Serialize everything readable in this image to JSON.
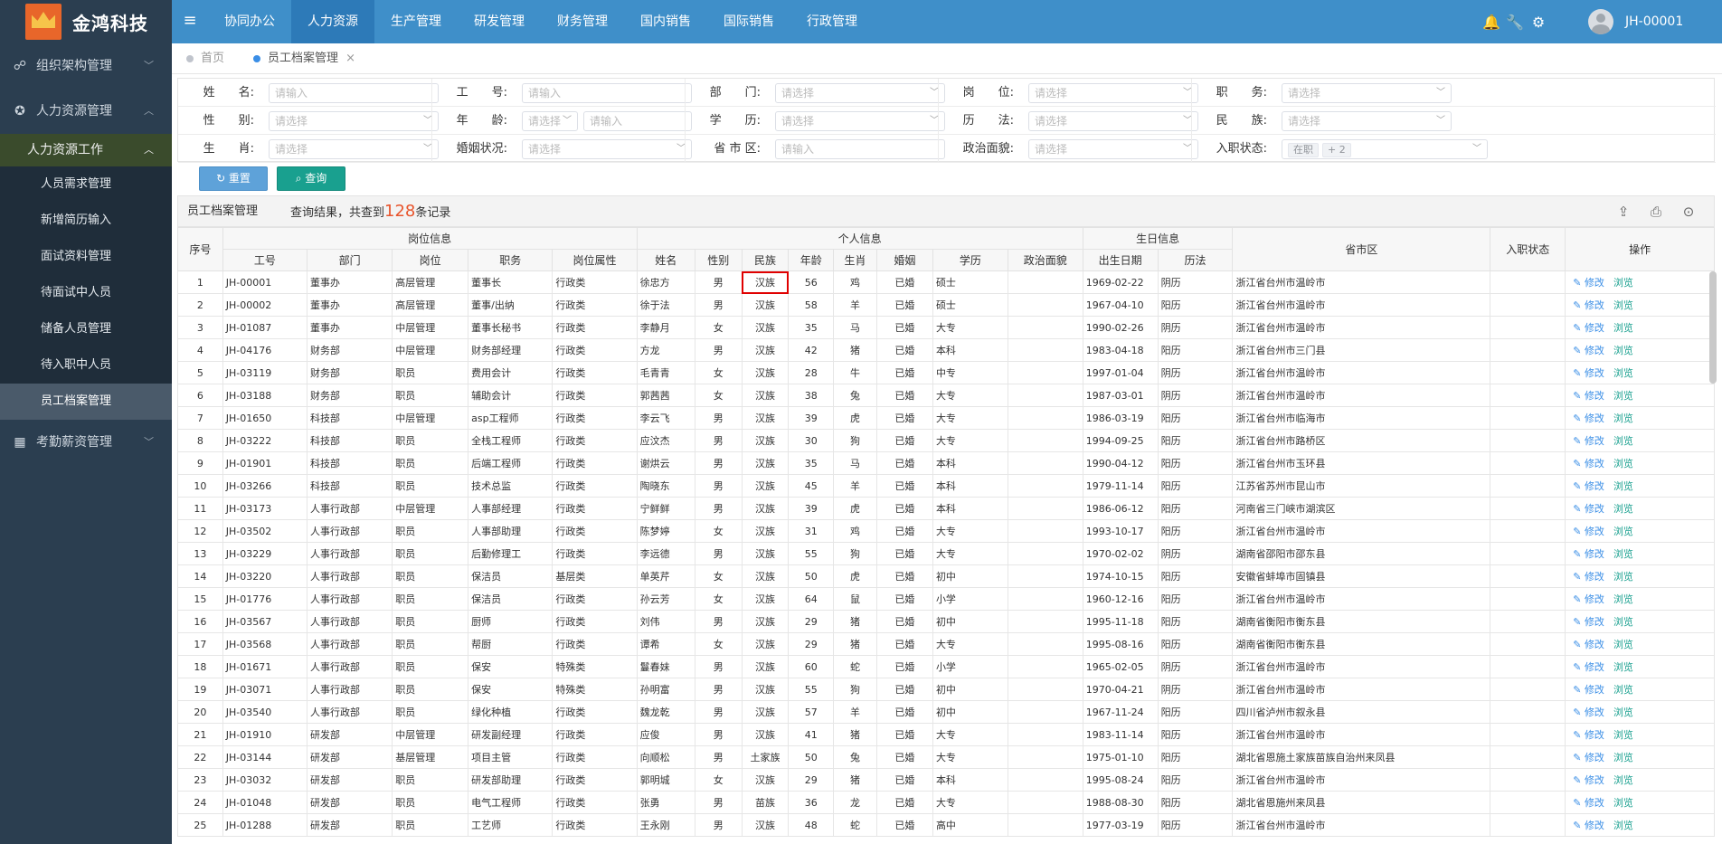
{
  "app": {
    "name": "金鸿科技",
    "menu_icon": "hamburger-icon"
  },
  "nav": [
    "协同办公",
    "人力资源",
    "生产管理",
    "研发管理",
    "财务管理",
    "国内销售",
    "国际销售",
    "行政管理"
  ],
  "nav_active": "人力资源",
  "topbar": {
    "icons": [
      "bell-icon",
      "wrench-icon",
      "gear-icon"
    ],
    "user": "JH-00001"
  },
  "sidebar": {
    "groups": [
      {
        "label": "组织架构管理",
        "icon": "org-chart-icon",
        "chevron": "chevron-down-icon"
      },
      {
        "label": "人力资源管理",
        "icon": "gear-icon",
        "chevron": "chevron-up-icon"
      }
    ],
    "subgroup": "人力资源工作",
    "items": [
      "人员需求管理",
      "新增简历输入",
      "面试资料管理",
      "待面试中人员",
      "储备人员管理",
      "待入职中人员",
      "员工档案管理"
    ],
    "active_item": "员工档案管理",
    "last_group": {
      "label": "考勤薪资管理",
      "icon": "grid-icon"
    }
  },
  "tabs": [
    {
      "label": "首页",
      "dot": "#c0c4cc"
    },
    {
      "label": "员工档案管理",
      "dot": "#3a8ee6",
      "close": "×"
    }
  ],
  "filters": {
    "row1": [
      {
        "label": "姓　　名:",
        "placeholder": "请输入"
      },
      {
        "label": "工　　号:",
        "placeholder": "请输入"
      },
      {
        "label": "部　　门:",
        "placeholder": "请选择"
      },
      {
        "label": "岗　　位:",
        "placeholder": "请选择"
      },
      {
        "label": "职　　务:",
        "placeholder": "请选择"
      }
    ],
    "row2": [
      {
        "label": "性　　别:",
        "placeholder": "请选择"
      },
      {
        "label": "年　　龄:",
        "placeholder": "请选择",
        "placeholder2": "请输入"
      },
      {
        "label": "学　　历:",
        "placeholder": "请选择"
      },
      {
        "label": "历　　法:",
        "placeholder": "请选择"
      },
      {
        "label": "民　　族:",
        "placeholder": "请选择"
      }
    ],
    "row3": [
      {
        "label": "生　　肖:",
        "placeholder": "请选择"
      },
      {
        "label": "婚姻状况:",
        "placeholder": "请选择"
      },
      {
        "label": "省 市 区:",
        "placeholder": "请输入"
      },
      {
        "label": "政治面貌:",
        "placeholder": "请选择"
      },
      {
        "label": "入职状态:",
        "tags": [
          "在职",
          "+ 2"
        ]
      }
    ]
  },
  "buttons": {
    "reset": "↻ 重置",
    "query": "⌕ 查询"
  },
  "list": {
    "title": "员工档案管理",
    "summary_pre": "查询结果，共查到",
    "count": "128",
    "summary_post": "条记录",
    "tools": [
      "export-icon",
      "print-icon",
      "locate-icon"
    ]
  },
  "table": {
    "group_headers": {
      "seq": "序号",
      "post": "岗位信息",
      "personal": "个人信息",
      "birth": "生日信息",
      "region": "省市区",
      "status": "入职状态",
      "ops": "操作"
    },
    "columns": [
      "工号",
      "部门",
      "岗位",
      "职务",
      "岗位属性",
      "姓名",
      "性别",
      "民族",
      "年龄",
      "生肖",
      "婚姻",
      "学历",
      "政治面貌",
      "出生日期",
      "历法"
    ],
    "op_edit": "修改",
    "op_view": "浏览",
    "rows": [
      [
        "1",
        "JH-00001",
        "董事办",
        "高层管理",
        "董事长",
        "行政类",
        "徐忠方",
        "男",
        "汉族",
        "56",
        "鸡",
        "已婚",
        "硕士",
        "",
        "1969-02-22",
        "阴历",
        "浙江省台州市温岭市",
        ""
      ],
      [
        "2",
        "JH-00002",
        "董事办",
        "高层管理",
        "董事/出纳",
        "行政类",
        "徐于法",
        "男",
        "汉族",
        "58",
        "羊",
        "已婚",
        "硕士",
        "",
        "1967-04-10",
        "阳历",
        "浙江省台州市温岭市",
        ""
      ],
      [
        "3",
        "JH-01087",
        "董事办",
        "中层管理",
        "董事长秘书",
        "行政类",
        "李静月",
        "女",
        "汉族",
        "35",
        "马",
        "已婚",
        "大专",
        "",
        "1990-02-26",
        "阴历",
        "浙江省台州市温岭市",
        ""
      ],
      [
        "4",
        "JH-04176",
        "财务部",
        "中层管理",
        "财务部经理",
        "行政类",
        "方龙",
        "男",
        "汉族",
        "42",
        "猪",
        "已婚",
        "本科",
        "",
        "1983-04-18",
        "阳历",
        "浙江省台州市三门县",
        ""
      ],
      [
        "5",
        "JH-03119",
        "财务部",
        "职员",
        "费用会计",
        "行政类",
        "毛青青",
        "女",
        "汉族",
        "28",
        "牛",
        "已婚",
        "中专",
        "",
        "1997-01-04",
        "阴历",
        "浙江省台州市温岭市",
        ""
      ],
      [
        "6",
        "JH-03188",
        "财务部",
        "职员",
        "辅助会计",
        "行政类",
        "郭茜茜",
        "女",
        "汉族",
        "38",
        "兔",
        "已婚",
        "大专",
        "",
        "1987-03-01",
        "阴历",
        "浙江省台州市温岭市",
        ""
      ],
      [
        "7",
        "JH-01650",
        "科技部",
        "中层管理",
        "asp工程师",
        "行政类",
        "李云飞",
        "男",
        "汉族",
        "39",
        "虎",
        "已婚",
        "大专",
        "",
        "1986-03-19",
        "阳历",
        "浙江省台州市临海市",
        ""
      ],
      [
        "8",
        "JH-03222",
        "科技部",
        "职员",
        "全栈工程师",
        "行政类",
        "应汶杰",
        "男",
        "汉族",
        "30",
        "狗",
        "已婚",
        "大专",
        "",
        "1994-09-25",
        "阳历",
        "浙江省台州市路桥区",
        ""
      ],
      [
        "9",
        "JH-01901",
        "科技部",
        "职员",
        "后端工程师",
        "行政类",
        "谢烘云",
        "男",
        "汉族",
        "35",
        "马",
        "已婚",
        "本科",
        "",
        "1990-04-12",
        "阳历",
        "浙江省台州市玉环县",
        ""
      ],
      [
        "10",
        "JH-03266",
        "科技部",
        "职员",
        "技术总监",
        "行政类",
        "陶晓东",
        "男",
        "汉族",
        "45",
        "羊",
        "已婚",
        "本科",
        "",
        "1979-11-14",
        "阳历",
        "江苏省苏州市昆山市",
        ""
      ],
      [
        "11",
        "JH-03173",
        "人事行政部",
        "中层管理",
        "人事部经理",
        "行政类",
        "宁鲜鲜",
        "男",
        "汉族",
        "39",
        "虎",
        "已婚",
        "本科",
        "",
        "1986-06-12",
        "阳历",
        "河南省三门峡市湖滨区",
        ""
      ],
      [
        "12",
        "JH-03502",
        "人事行政部",
        "职员",
        "人事部助理",
        "行政类",
        "陈梦婷",
        "女",
        "汉族",
        "31",
        "鸡",
        "已婚",
        "大专",
        "",
        "1993-10-17",
        "阳历",
        "浙江省台州市温岭市",
        ""
      ],
      [
        "13",
        "JH-03229",
        "人事行政部",
        "职员",
        "后勤修理工",
        "行政类",
        "李远德",
        "男",
        "汉族",
        "55",
        "狗",
        "已婚",
        "大专",
        "",
        "1970-02-02",
        "阴历",
        "湖南省邵阳市邵东县",
        ""
      ],
      [
        "14",
        "JH-03220",
        "人事行政部",
        "职员",
        "保洁员",
        "基层类",
        "单英芹",
        "女",
        "汉族",
        "50",
        "虎",
        "已婚",
        "初中",
        "",
        "1974-10-15",
        "阳历",
        "安徽省蚌埠市固镇县",
        ""
      ],
      [
        "15",
        "JH-01776",
        "人事行政部",
        "职员",
        "保洁员",
        "行政类",
        "孙云芳",
        "女",
        "汉族",
        "64",
        "鼠",
        "已婚",
        "小学",
        "",
        "1960-12-16",
        "阳历",
        "浙江省台州市温岭市",
        ""
      ],
      [
        "16",
        "JH-03567",
        "人事行政部",
        "职员",
        "厨师",
        "行政类",
        "刘伟",
        "男",
        "汉族",
        "29",
        "猪",
        "已婚",
        "初中",
        "",
        "1995-11-18",
        "阳历",
        "湖南省衡阳市衡东县",
        ""
      ],
      [
        "17",
        "JH-03568",
        "人事行政部",
        "职员",
        "帮厨",
        "行政类",
        "谭希",
        "女",
        "汉族",
        "29",
        "猪",
        "已婚",
        "大专",
        "",
        "1995-08-16",
        "阳历",
        "湖南省衡阳市衡东县",
        ""
      ],
      [
        "18",
        "JH-01671",
        "人事行政部",
        "职员",
        "保安",
        "特殊类",
        "鬘春妹",
        "男",
        "汉族",
        "60",
        "蛇",
        "已婚",
        "小学",
        "",
        "1965-02-05",
        "阴历",
        "浙江省台州市温岭市",
        ""
      ],
      [
        "19",
        "JH-03071",
        "人事行政部",
        "职员",
        "保安",
        "特殊类",
        "孙明富",
        "男",
        "汉族",
        "55",
        "狗",
        "已婚",
        "初中",
        "",
        "1970-04-21",
        "阴历",
        "浙江省台州市温岭市",
        ""
      ],
      [
        "20",
        "JH-03540",
        "人事行政部",
        "职员",
        "绿化种植",
        "行政类",
        "魏龙乾",
        "男",
        "汉族",
        "57",
        "羊",
        "已婚",
        "初中",
        "",
        "1967-11-24",
        "阳历",
        "四川省泸州市叙永县",
        ""
      ],
      [
        "21",
        "JH-01910",
        "研发部",
        "中层管理",
        "研发副经理",
        "行政类",
        "应俊",
        "男",
        "汉族",
        "41",
        "猪",
        "已婚",
        "大专",
        "",
        "1983-11-14",
        "阳历",
        "浙江省台州市温岭市",
        ""
      ],
      [
        "22",
        "JH-03144",
        "研发部",
        "基层管理",
        "项目主管",
        "行政类",
        "向顺松",
        "男",
        "土家族",
        "50",
        "兔",
        "已婚",
        "大专",
        "",
        "1975-01-10",
        "阳历",
        "湖北省恩施土家族苗族自治州来凤县",
        ""
      ],
      [
        "23",
        "JH-03032",
        "研发部",
        "职员",
        "研发部助理",
        "行政类",
        "郭明城",
        "女",
        "汉族",
        "29",
        "猪",
        "已婚",
        "本科",
        "",
        "1995-08-24",
        "阳历",
        "浙江省台州市温岭市",
        ""
      ],
      [
        "24",
        "JH-01048",
        "研发部",
        "职员",
        "电气工程师",
        "行政类",
        "张勇",
        "男",
        "苗族",
        "36",
        "龙",
        "已婚",
        "大专",
        "",
        "1988-08-30",
        "阳历",
        "湖北省恩施州来凤县",
        ""
      ],
      [
        "25",
        "JH-01288",
        "研发部",
        "职员",
        "工艺师",
        "行政类",
        "王永刚",
        "男",
        "汉族",
        "48",
        "蛇",
        "已婚",
        "高中",
        "",
        "1977-03-19",
        "阳历",
        "浙江省台州市温岭市",
        ""
      ]
    ]
  }
}
